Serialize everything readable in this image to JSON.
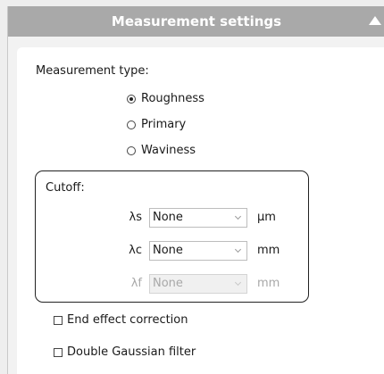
{
  "header": {
    "title": "Measurement settings"
  },
  "measurement_type": {
    "label": "Measurement type:",
    "options": [
      {
        "label": "Roughness",
        "checked": true
      },
      {
        "label": "Primary",
        "checked": false
      },
      {
        "label": "Waviness",
        "checked": false
      }
    ]
  },
  "cutoff": {
    "label": "Cutoff:",
    "rows": [
      {
        "symbol": "λs",
        "value": "None",
        "unit": "µm",
        "enabled": true
      },
      {
        "symbol": "λc",
        "value": "None",
        "unit": "mm",
        "enabled": true
      },
      {
        "symbol": "λf",
        "value": "None",
        "unit": "mm",
        "enabled": false
      }
    ]
  },
  "options": {
    "end_effect_label": "End effect correction",
    "double_gaussian_label": "Double Gaussian filter"
  }
}
